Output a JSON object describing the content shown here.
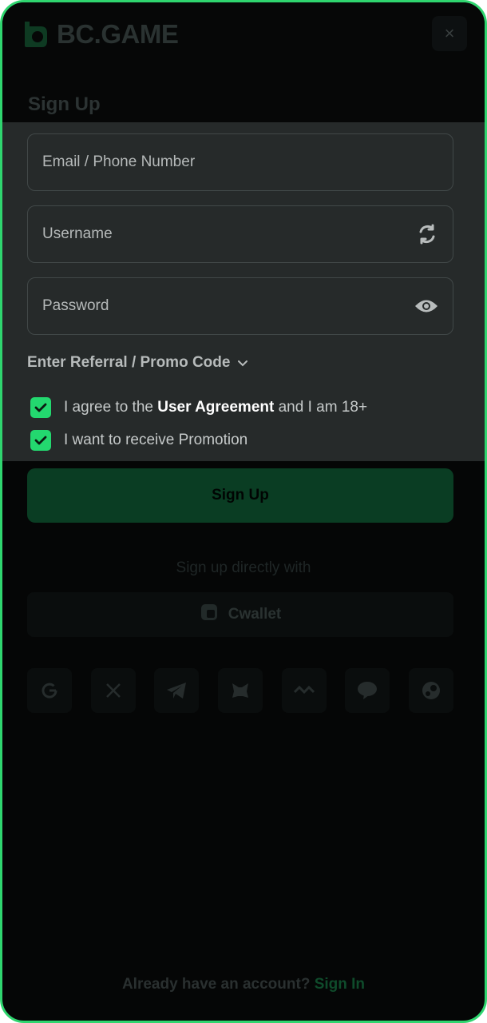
{
  "header": {
    "logo_text": "BC.GAME",
    "close_label": "×"
  },
  "form": {
    "title": "Sign Up",
    "email_placeholder": "Email / Phone Number",
    "username_placeholder": "Username",
    "password_placeholder": "Password",
    "referral_label": "Enter Referral / Promo Code",
    "agreement": {
      "prefix": "I agree to the ",
      "link": "User Agreement",
      "suffix": " and I am 18+",
      "checked": true
    },
    "promotion": {
      "label": "I want to receive Promotion",
      "checked": true
    },
    "submit_label": "Sign Up"
  },
  "social": {
    "heading": "Sign up directly with",
    "cwallet_label": "Cwallet",
    "providers": [
      "google-icon",
      "x-icon",
      "telegram-icon",
      "metamask-icon",
      "waves-icon",
      "line-icon",
      "steam-icon"
    ]
  },
  "footer": {
    "prompt": "Already have an account? ",
    "link": "Sign In"
  },
  "colors": {
    "accent": "#23d86f",
    "frame_border": "#2fd56f",
    "form_bg": "#262a2a",
    "page_bg": "#050606"
  }
}
